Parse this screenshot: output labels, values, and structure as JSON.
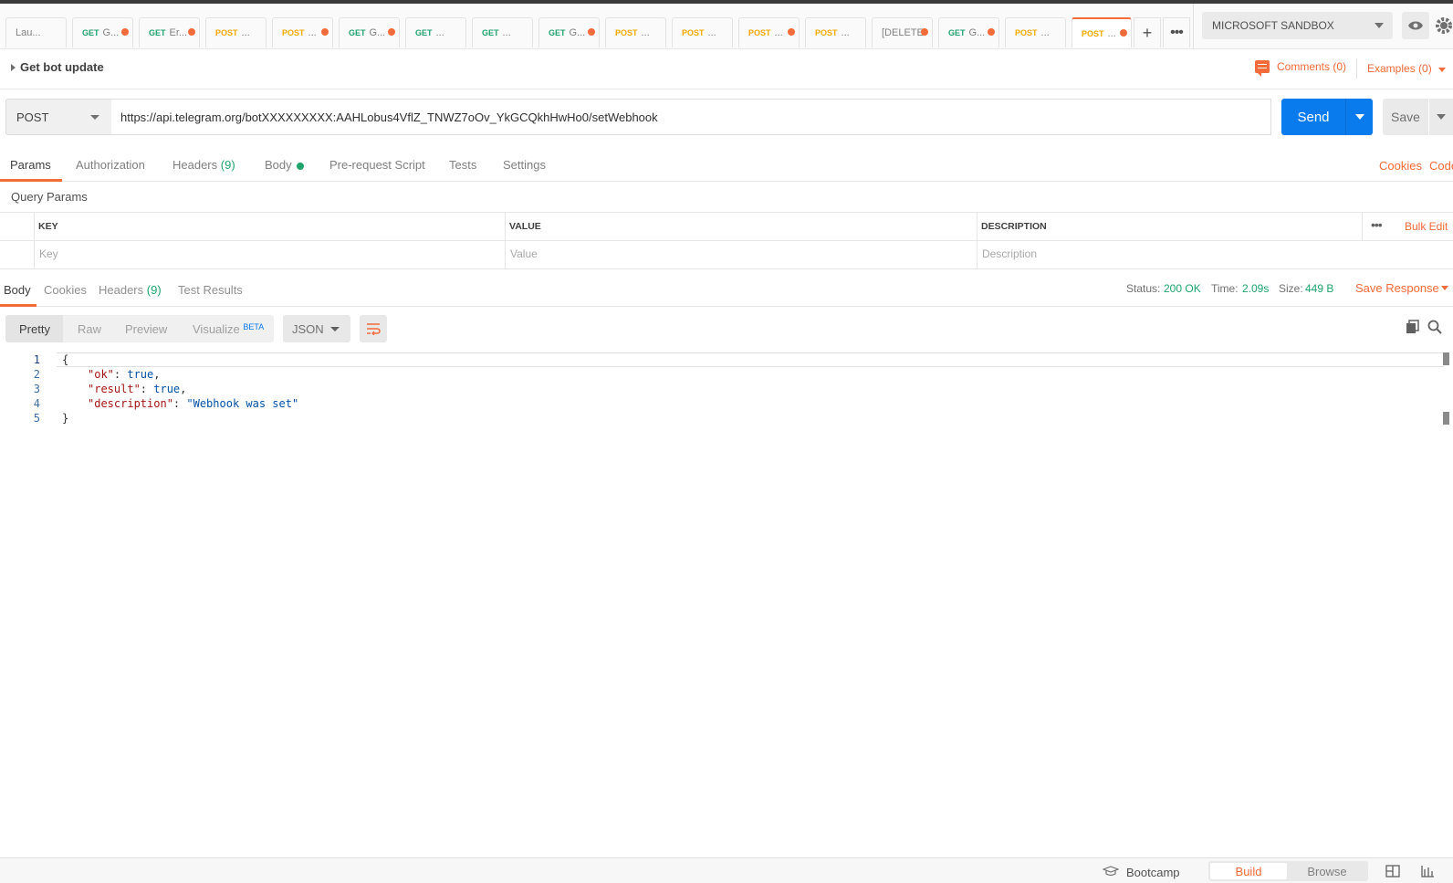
{
  "tabs": [
    {
      "method": "",
      "title": "Lau...",
      "dot": false
    },
    {
      "method": "GET",
      "title": "G...",
      "dot": true
    },
    {
      "method": "GET",
      "title": "Er...",
      "dot": true
    },
    {
      "method": "POST",
      "title": "...",
      "dot": false
    },
    {
      "method": "POST",
      "title": "...",
      "dot": true
    },
    {
      "method": "GET",
      "title": "G...",
      "dot": true
    },
    {
      "method": "GET",
      "title": "...",
      "dot": false
    },
    {
      "method": "GET",
      "title": "...",
      "dot": false
    },
    {
      "method": "GET",
      "title": "G...",
      "dot": true
    },
    {
      "method": "POST",
      "title": "...",
      "dot": false
    },
    {
      "method": "POST",
      "title": "...",
      "dot": false
    },
    {
      "method": "POST",
      "title": "...",
      "dot": true
    },
    {
      "method": "POST",
      "title": "...",
      "dot": false
    },
    {
      "method": "",
      "title": "[DELETEI",
      "dot": true
    },
    {
      "method": "GET",
      "title": "G...",
      "dot": true
    },
    {
      "method": "POST",
      "title": "...",
      "dot": false
    },
    {
      "method": "POST",
      "title": "...",
      "dot": true,
      "active": true
    }
  ],
  "tab_add_label": "+",
  "tab_more_label": "•••",
  "environment": {
    "selected": "MICROSOFT SANDBOX"
  },
  "request": {
    "title": "Get bot update",
    "comments_label": "Comments (0)",
    "examples_label": "Examples (0)",
    "method": "POST",
    "url": "https://api.telegram.org/botXXXXXXXXX:AAHLobus4VflZ_TNWZ7oOv_YkGCQkhHwHo0/setWebhook",
    "send_label": "Send",
    "save_label": "Save"
  },
  "request_tabs": {
    "params": "Params",
    "authorization": "Authorization",
    "headers": "Headers",
    "headers_count": "(9)",
    "body": "Body",
    "prerequest": "Pre-request Script",
    "tests": "Tests",
    "settings": "Settings",
    "cookies": "Cookies",
    "code": "Code"
  },
  "query_params": {
    "title": "Query Params",
    "headers": {
      "key": "KEY",
      "value": "VALUE",
      "description": "DESCRIPTION"
    },
    "bulk_edit": "Bulk Edit",
    "more": "•••",
    "placeholders": {
      "key": "Key",
      "value": "Value",
      "description": "Description"
    }
  },
  "response": {
    "tabs": {
      "body": "Body",
      "cookies": "Cookies",
      "headers": "Headers",
      "headers_count": "(9)",
      "test_results": "Test Results"
    },
    "status_label": "Status:",
    "status_value": "200 OK",
    "time_label": "Time:",
    "time_value": "2.09s",
    "size_label": "Size:",
    "size_value": "449 B",
    "save_response": "Save Response",
    "views": {
      "pretty": "Pretty",
      "raw": "Raw",
      "preview": "Preview",
      "visualize": "Visualize",
      "beta": "BETA"
    },
    "format": "JSON",
    "lines": [
      "1",
      "2",
      "3",
      "4",
      "5"
    ],
    "body": {
      "open": "{",
      "ok_key": "\"ok\"",
      "ok_val": "true",
      "result_key": "\"result\"",
      "result_val": "true",
      "desc_key": "\"description\"",
      "desc_val": "\"Webhook was set\"",
      "close": "}"
    }
  },
  "footer": {
    "bootcamp": "Bootcamp",
    "build": "Build",
    "browse": "Browse"
  },
  "colors": {
    "accent": "#f26b3a",
    "primary": "#097bed",
    "get": "#21a36d",
    "post": "#f4a900"
  }
}
